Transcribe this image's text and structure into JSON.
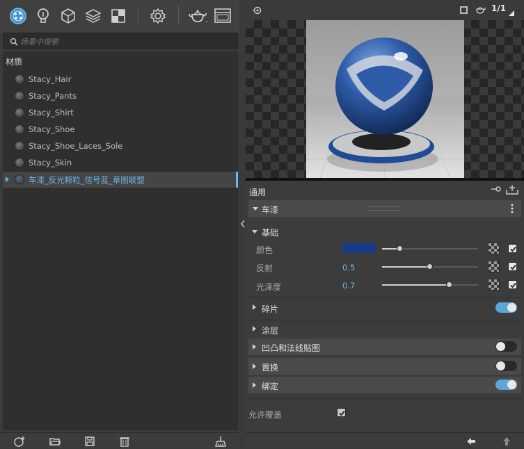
{
  "search": {
    "placeholder": "场景中搜索"
  },
  "tree": {
    "header": "材质",
    "items": [
      {
        "label": "Stacy_Hair"
      },
      {
        "label": "Stacy_Pants"
      },
      {
        "label": "Stacy_Shirt"
      },
      {
        "label": "Stacy_Shoe"
      },
      {
        "label": "Stacy_Shoe_Laces_Sole"
      },
      {
        "label": "Stacy_Skin"
      },
      {
        "label": "车漆_反光颗粒_信号蓝_草图联盟",
        "selected": true
      }
    ]
  },
  "viewport": {
    "render_counter": "1/1"
  },
  "properties": {
    "section_general": "通用",
    "material_name": "车漆",
    "group_base": "基础",
    "color_label": "颜色",
    "color_value": "#1a3a8a",
    "reflection_label": "反射",
    "reflection_value": "0.5",
    "gloss_label": "光泽度",
    "gloss_value": "0.7",
    "flakes_label": "碎片",
    "coating_label": "涂层",
    "bump_label": "凹凸和法线贴图",
    "displacement_label": "置换",
    "binding_label": "绑定",
    "allow_override_label": "允许覆盖"
  },
  "toggles": {
    "flakes": true,
    "bump": false,
    "displacement": false,
    "binding": true
  },
  "sliders": {
    "color": 0.19,
    "reflection": 0.5,
    "gloss": 0.7
  },
  "colors": {
    "accent": "#5aa7d8",
    "selected_text": "#6fb6e6"
  }
}
